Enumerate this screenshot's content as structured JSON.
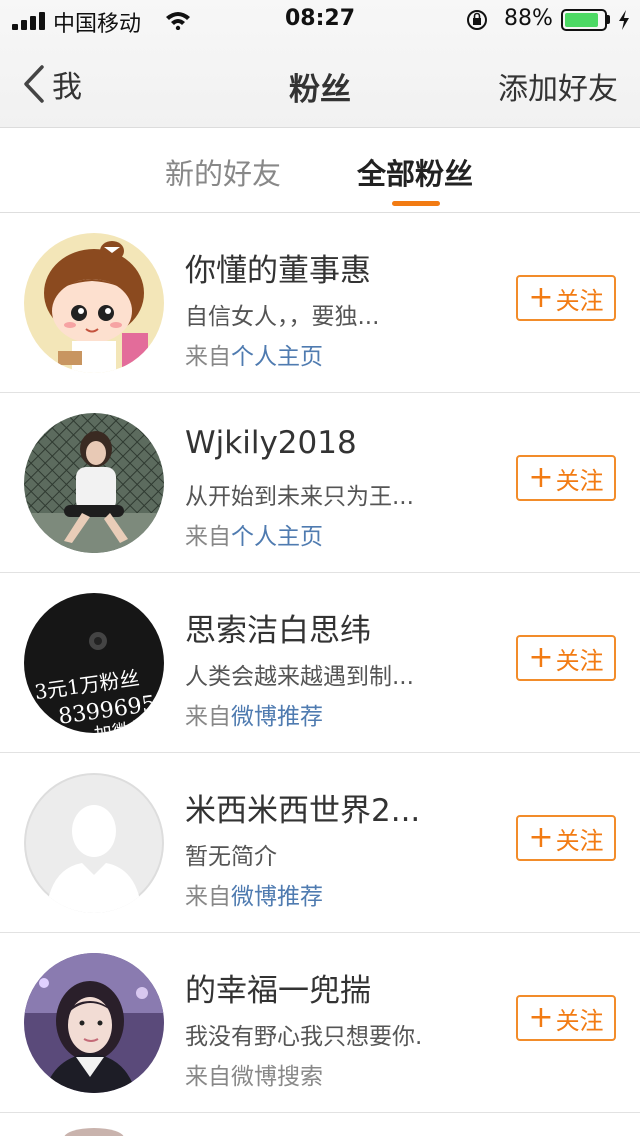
{
  "status_bar": {
    "carrier": "中国移动",
    "time": "08:27",
    "battery_percent": "88%",
    "battery_level": 0.88,
    "battery_color": "#4cd964"
  },
  "nav": {
    "back_label": "我",
    "title": "粉丝",
    "add_friend": "添加好友"
  },
  "tabs": {
    "new_friends": "新的好友",
    "all_fans": "全部粉丝",
    "active": "全部粉丝",
    "accent_color": "#f27b13"
  },
  "fans": [
    {
      "name": "你懂的董事惠",
      "desc": "自信女人，，要独...",
      "source_prefix": "来自",
      "source": "个人主页",
      "source_link": true,
      "follow_label": "关注",
      "avatar": "cartoon-girl-avatar"
    },
    {
      "name": "Wjkily2018",
      "desc": "从开始到未来只为王...",
      "source_prefix": "来自",
      "source": "个人主页",
      "source_link": true,
      "follow_label": "关注",
      "avatar": "photo-avatar"
    },
    {
      "name": "思索洁白思纬",
      "desc": "人类会越来越遇到制...",
      "source_prefix": "来自",
      "source": "微博推荐",
      "source_link": true,
      "follow_label": "关注",
      "avatar": "dark-ad-avatar",
      "avatar_text_1": "3元1万粉丝",
      "avatar_text_2": "8399695",
      "avatar_text_3": "加微信"
    },
    {
      "name": "米西米西世界2...",
      "desc": "暂无简介",
      "source_prefix": "来自",
      "source": "微博推荐",
      "source_link": true,
      "follow_label": "关注",
      "avatar": "default-avatar"
    },
    {
      "name": "的幸福一兜揣",
      "desc": "我没有野心我只想要你.",
      "source_prefix": "来自",
      "source": "微博搜索",
      "source_link": false,
      "follow_label": "关注",
      "avatar": "photo-avatar"
    }
  ]
}
